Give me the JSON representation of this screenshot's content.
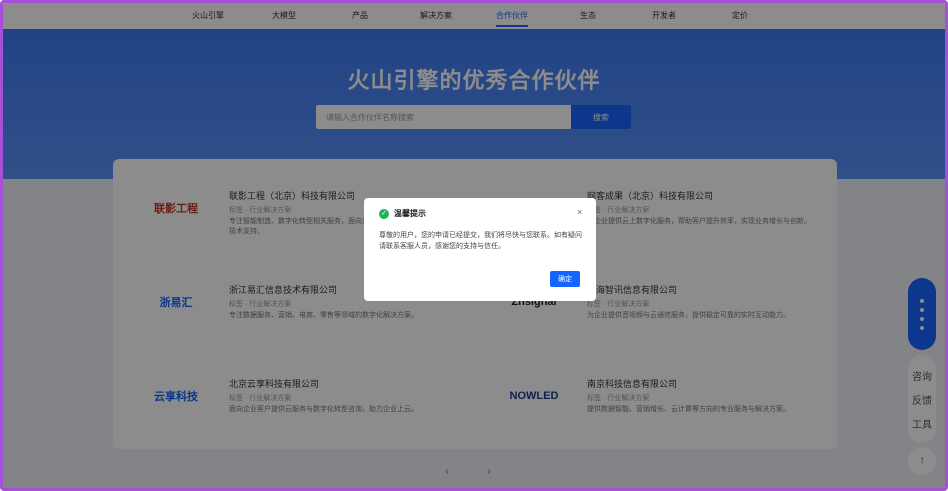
{
  "nav": {
    "items": [
      "火山引擎",
      "大模型",
      "产品",
      "解决方案",
      "合作伙伴",
      "生态",
      "开发者",
      "定价"
    ],
    "active_index": 4
  },
  "hero": {
    "title": "火山引擎的优秀合作伙伴"
  },
  "search": {
    "value": "请输入合作伙伴名称搜索",
    "button_label": "搜索"
  },
  "partners": [
    {
      "logo_text": "联影工程",
      "logo_color": "#c0392b",
      "name": "联影工程（北京）科技有限公司",
      "tag": "标签 · 行业解决方案",
      "desc": "专注智能制造、数字化转型相关服务，面向企业客户提供一站式解决方案与技术支持。"
    },
    {
      "logo_text": "",
      "logo_color": "#333333",
      "name": "网客成果（北京）科技有限公司",
      "tag": "标签 · 行业解决方案",
      "desc": "为企业提供云上数字化服务，帮助客户提升效率，实现业务增长与创新。"
    },
    {
      "logo_text": "浙易汇",
      "logo_color": "#1664ff",
      "name": "浙江易汇信息技术有限公司",
      "tag": "标签 · 行业解决方案",
      "desc": "专注数据服务、营销、电商、零售等领域的数字化解决方案。"
    },
    {
      "logo_text": "Zhsignal",
      "logo_color": "#222222",
      "name": "上海智讯信息有限公司",
      "tag": "标签 · 行业解决方案",
      "desc": "为企业提供音视频与云通信服务，提供稳定可靠的实时互动能力。"
    },
    {
      "logo_text": "云享科技",
      "logo_color": "#1664ff",
      "name": "北京云享科技有限公司",
      "tag": "标签 · 行业解决方案",
      "desc": "面向企业客户提供云服务与数字化转型咨询，助力企业上云。"
    },
    {
      "logo_text": "NOWLED",
      "logo_color": "#1a3c8c",
      "name": "南京科技信息有限公司",
      "tag": "标签 · 行业解决方案",
      "desc": "提供数据智能、营销增长、云计算等方向的专业服务与解决方案。"
    }
  ],
  "pagination": {
    "prev": "‹",
    "next": "›"
  },
  "side_tools": [
    "咨询",
    "反馈",
    "工具"
  ],
  "back_to_top": "↑",
  "modal": {
    "title": "温馨提示",
    "close": "×",
    "body": "尊敬的用户，您的申请已经提交，我们将尽快与您联系。如有疑问请联系客服人员，感谢您的支持与信任。",
    "ok_label": "确定"
  }
}
